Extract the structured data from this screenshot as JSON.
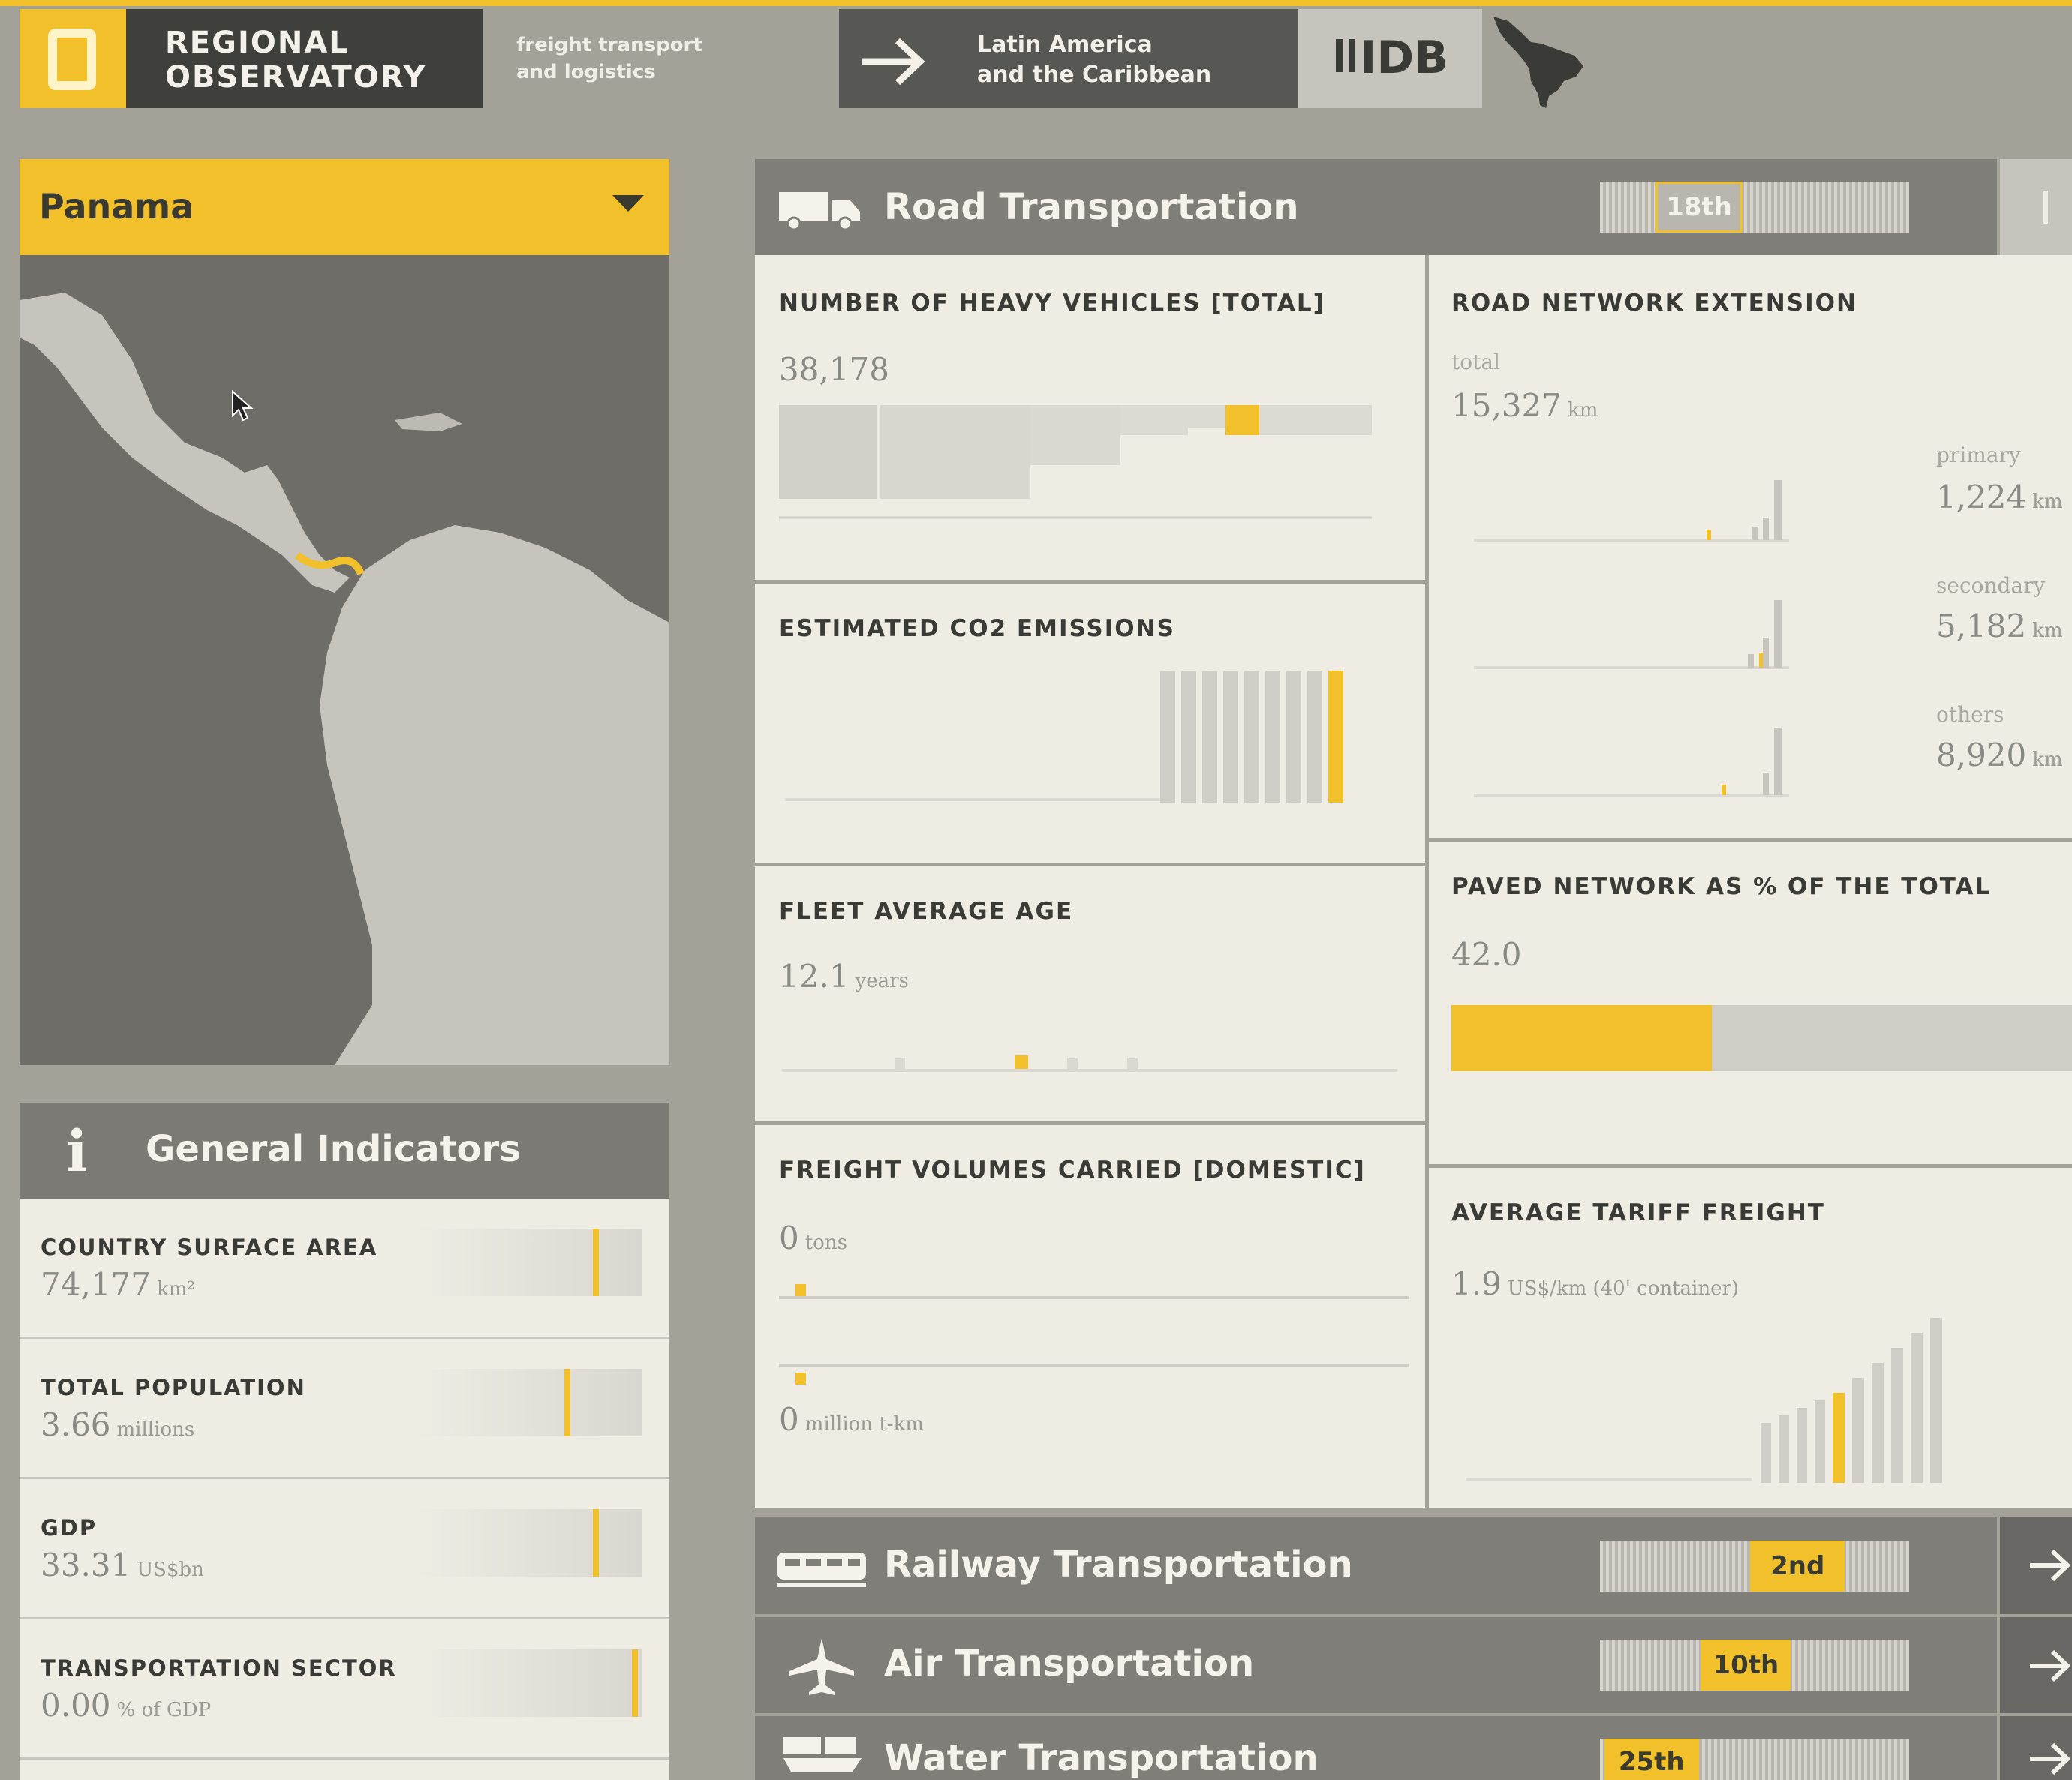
{
  "header": {
    "logo_line1": "REGIONAL",
    "logo_line2": "OBSERVATORY",
    "subtitle_line1": "freight transport",
    "subtitle_line2": "and logistics",
    "region_line1": "Latin America",
    "region_line2": "and the Caribbean",
    "org": "IDB"
  },
  "country_select": {
    "value": "Panama"
  },
  "general": {
    "title": "General Indicators",
    "items": [
      {
        "label": "COUNTRY SURFACE AREA",
        "value": "74,177",
        "unit": "km²",
        "level": 0.8
      },
      {
        "label": "TOTAL POPULATION",
        "value": "3.66",
        "unit": "millions",
        "level": 0.67
      },
      {
        "label": "GDP",
        "value": "33.31",
        "unit": "US$bn",
        "level": 0.8
      },
      {
        "label": "TRANSPORTATION SECTOR",
        "value": "0.00",
        "unit": "% of GDP",
        "level": 0.98
      }
    ]
  },
  "road": {
    "title": "Road Transportation",
    "rank": "18th",
    "rank_level": 0.25,
    "heavy_vehicles": {
      "title": "NUMBER OF HEAVY VEHICLES [TOTAL]",
      "value": "38,178"
    },
    "network": {
      "title": "ROAD NETWORK EXTENSION",
      "total_label": "total",
      "total_value": "15,327",
      "unit": "km",
      "primary_label": "primary",
      "primary_value": "1,224",
      "secondary_label": "secondary",
      "secondary_value": "5,182",
      "others_label": "others",
      "others_value": "8,920"
    },
    "co2": {
      "title": "ESTIMATED CO2 EMISSIONS"
    },
    "fleet": {
      "title": "FLEET AVERAGE AGE",
      "value": "12.1",
      "unit": "years"
    },
    "paved": {
      "title": "PAVED NETWORK AS % OF THE TOTAL",
      "value": "42.0",
      "level": 0.42
    },
    "freight": {
      "title": "FREIGHT VOLUMES CARRIED [DOMESTIC]",
      "value1": "0",
      "unit1": "tons",
      "value2": "0",
      "unit2": "million t-km"
    },
    "tariff": {
      "title": "AVERAGE TARIFF FREIGHT",
      "value": "1.9",
      "unit": "US$/km (40' container)"
    }
  },
  "other_sections": [
    {
      "title": "Railway Transportation",
      "rank": "2nd",
      "rank_level": 0.7
    },
    {
      "title": "Air Transportation",
      "rank": "10th",
      "rank_level": 0.46
    },
    {
      "title": "Water Transportation",
      "rank": "25th",
      "rank_level": 0.02
    }
  ],
  "colors": {
    "accent": "#f1c02a",
    "panel": "#eeece3",
    "header_dark": "#3f3f3c",
    "section_header": "#807e78"
  },
  "icons": [
    "logo-mark-icon",
    "arrow-right-icon",
    "idb-logo",
    "latin-america-map-icon",
    "dropdown-arrow-icon",
    "info-icon",
    "truck-icon",
    "train-icon",
    "airplane-icon",
    "ship-icon",
    "cursor-icon"
  ]
}
